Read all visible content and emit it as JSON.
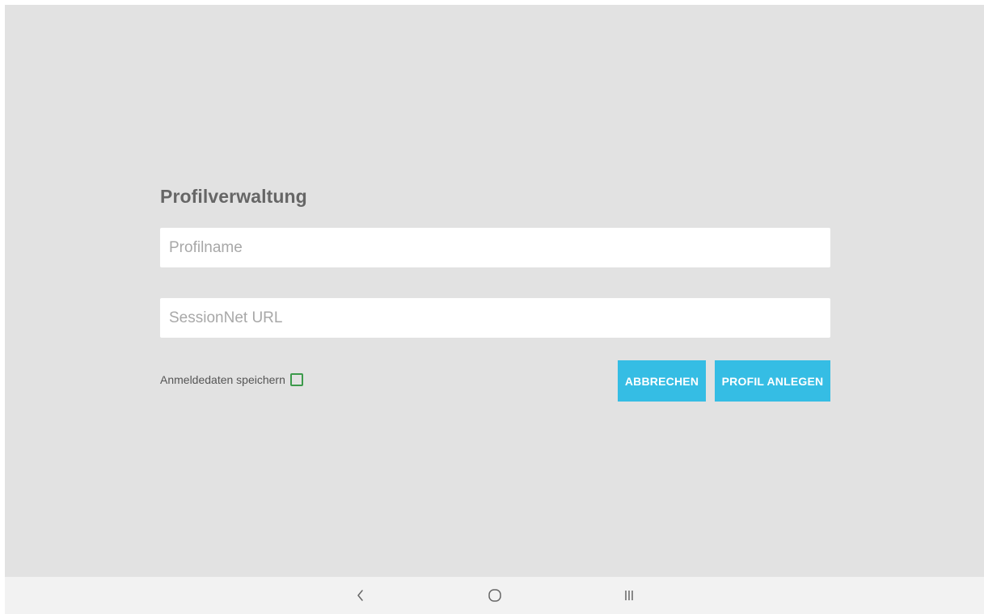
{
  "form": {
    "title": "Profilverwaltung",
    "profilname_placeholder": "Profilname",
    "profilname_value": "",
    "url_placeholder": "SessionNet URL",
    "url_value": "",
    "remember_label": "Anmeldedaten speichern",
    "remember_checked": false,
    "cancel_label": "ABBRECHEN",
    "create_label": "PROFIL ANLEGEN"
  },
  "navbar": {
    "back_icon": "chevron-left-icon",
    "home_icon": "home-circle-icon",
    "recent_icon": "recent-apps-icon"
  },
  "colors": {
    "background": "#e2e2e2",
    "button": "#35bde4",
    "checkbox_border": "#3c9a4b",
    "title": "#666666",
    "navbar": "#f2f2f2"
  }
}
